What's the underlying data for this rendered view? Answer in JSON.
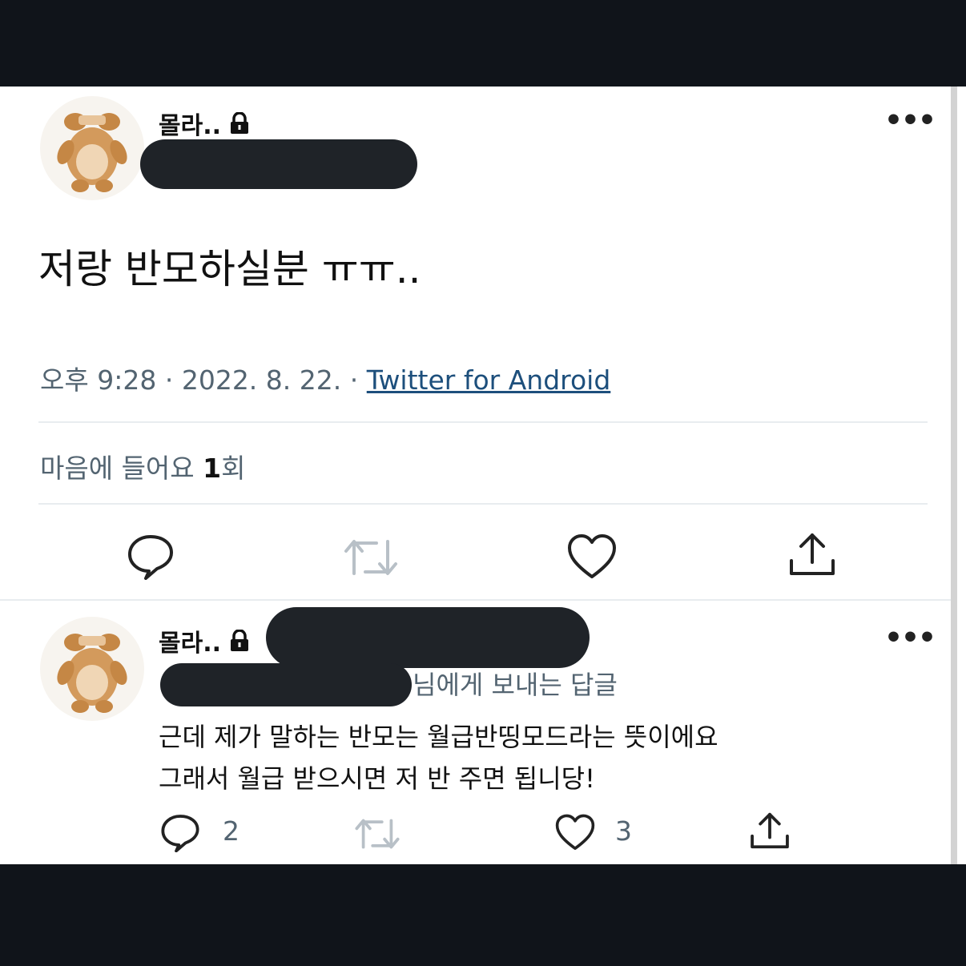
{
  "main_tweet": {
    "username": "몰라..",
    "text": "저랑 반모하실분 ㅠㅠ..",
    "time": "오후 9:28",
    "date": "2022. 8. 22.",
    "separator": "·",
    "source": "Twitter for Android",
    "likes_label": "마음에 들어요",
    "likes_count": "1",
    "likes_suffix": "회"
  },
  "reply": {
    "username": "몰라..",
    "reply_to_suffix": "님에게 보내는 답글",
    "text_line1": "근데 제가 말하는 반모는 월급반띵모드라는 뜻이에요",
    "text_line2": "그래서 월급 받으시면 저 반 주면 됩니당!",
    "reply_count": "2",
    "like_count": "3"
  },
  "icons": {
    "lock": "lock-icon",
    "more": "more-icon",
    "reply": "reply-icon",
    "retweet": "retweet-icon",
    "like": "heart-icon",
    "share": "share-icon"
  },
  "colors": {
    "link": "#1d4f7c",
    "muted": "#536471",
    "redaction": "#1f2328"
  }
}
